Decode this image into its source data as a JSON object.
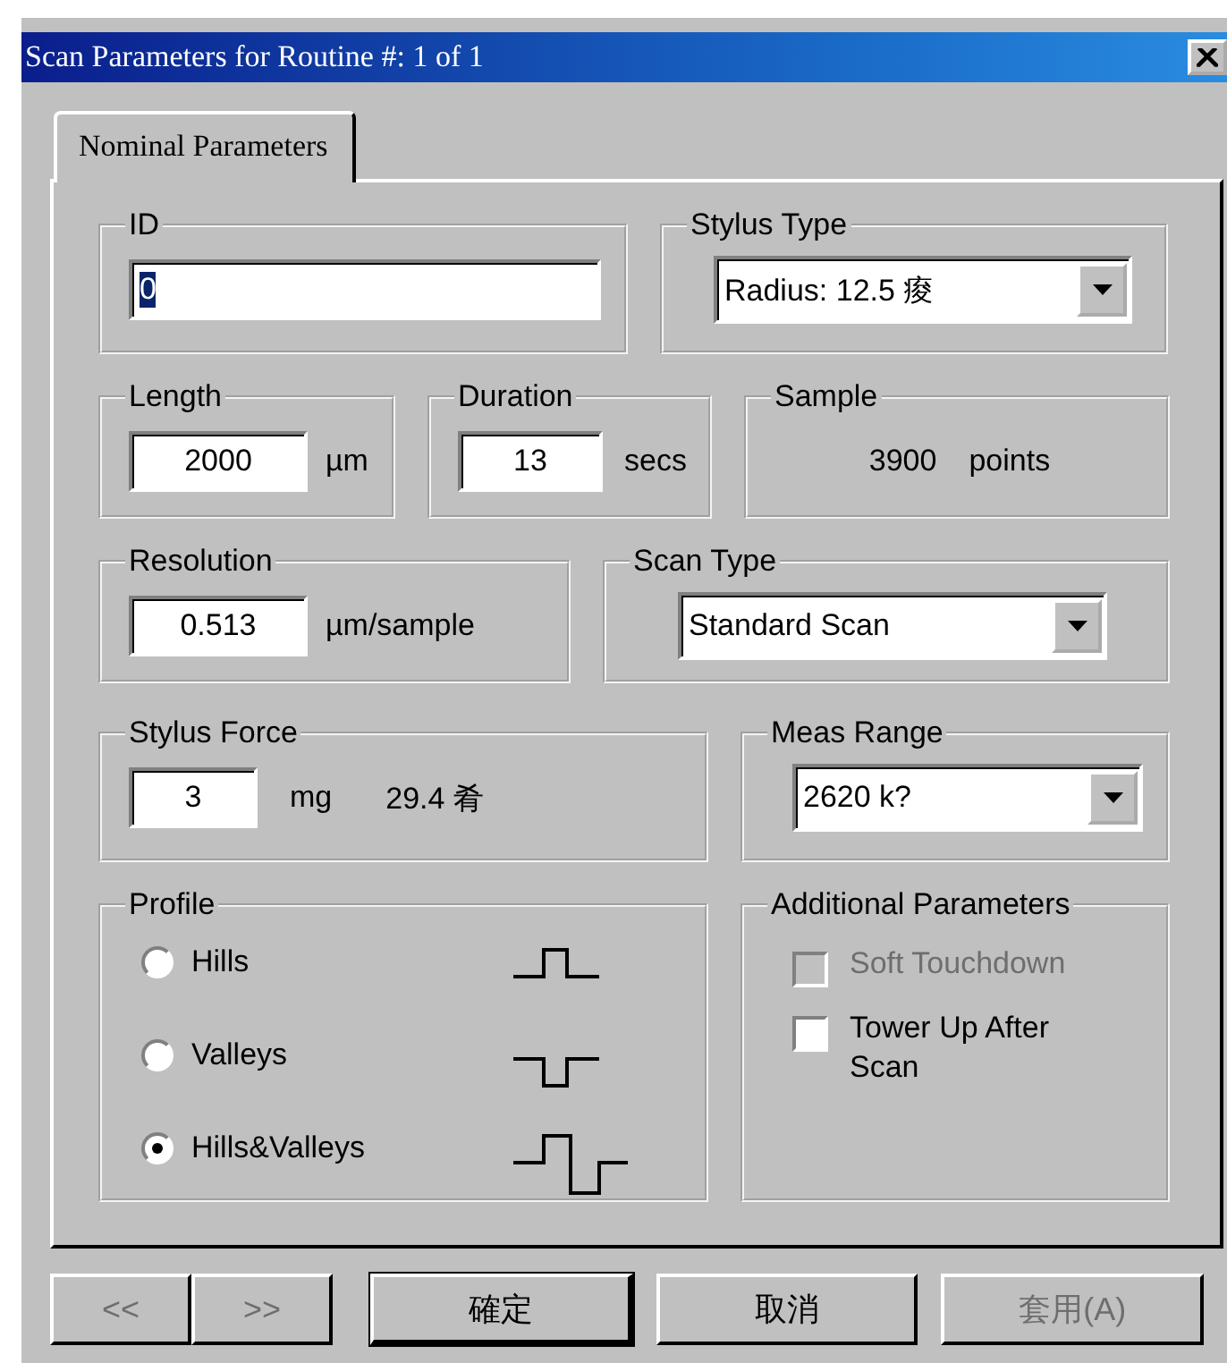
{
  "window": {
    "title": "Scan Parameters for Routine #: 1 of 1"
  },
  "tabs": [
    {
      "label": "Nominal Parameters",
      "selected": true
    }
  ],
  "id": {
    "label": "ID",
    "value": "0"
  },
  "stylus_type": {
    "label": "Stylus Type",
    "value": "Radius: 12.5 痠"
  },
  "length": {
    "label": "Length",
    "value": "2000",
    "unit": "µm"
  },
  "duration": {
    "label": "Duration",
    "value": "13",
    "unit": "secs"
  },
  "sample": {
    "label": "Sample",
    "value": "3900",
    "unit": "points"
  },
  "resolution": {
    "label": "Resolution",
    "value": "0.513",
    "unit": "µm/sample"
  },
  "scan_type": {
    "label": "Scan Type",
    "value": "Standard Scan"
  },
  "stylus_force": {
    "label": "Stylus Force",
    "value": "3",
    "unit": "mg",
    "reading": "29.4 肴"
  },
  "meas_range": {
    "label": "Meas Range",
    "value": "2620 k?"
  },
  "profile": {
    "label": "Profile",
    "options": [
      {
        "label": "Hills",
        "kind": "hills",
        "selected": false
      },
      {
        "label": "Valleys",
        "kind": "valleys",
        "selected": false
      },
      {
        "label": "Hills&Valleys",
        "kind": "both",
        "selected": true
      }
    ]
  },
  "additional": {
    "label": "Additional Parameters",
    "options": [
      {
        "label": "Soft Touchdown",
        "checked": false,
        "disabled": true
      },
      {
        "label": "Tower Up After Scan",
        "checked": false,
        "disabled": false
      }
    ]
  },
  "nav_buttons": [
    {
      "label": "<<",
      "disabled": true
    },
    {
      "label": ">>",
      "disabled": true
    }
  ],
  "buttons": [
    {
      "label": "確定",
      "default": true,
      "disabled": false
    },
    {
      "label": "取消",
      "default": false,
      "disabled": false
    },
    {
      "label": "套用(A)",
      "default": false,
      "disabled": true
    }
  ]
}
